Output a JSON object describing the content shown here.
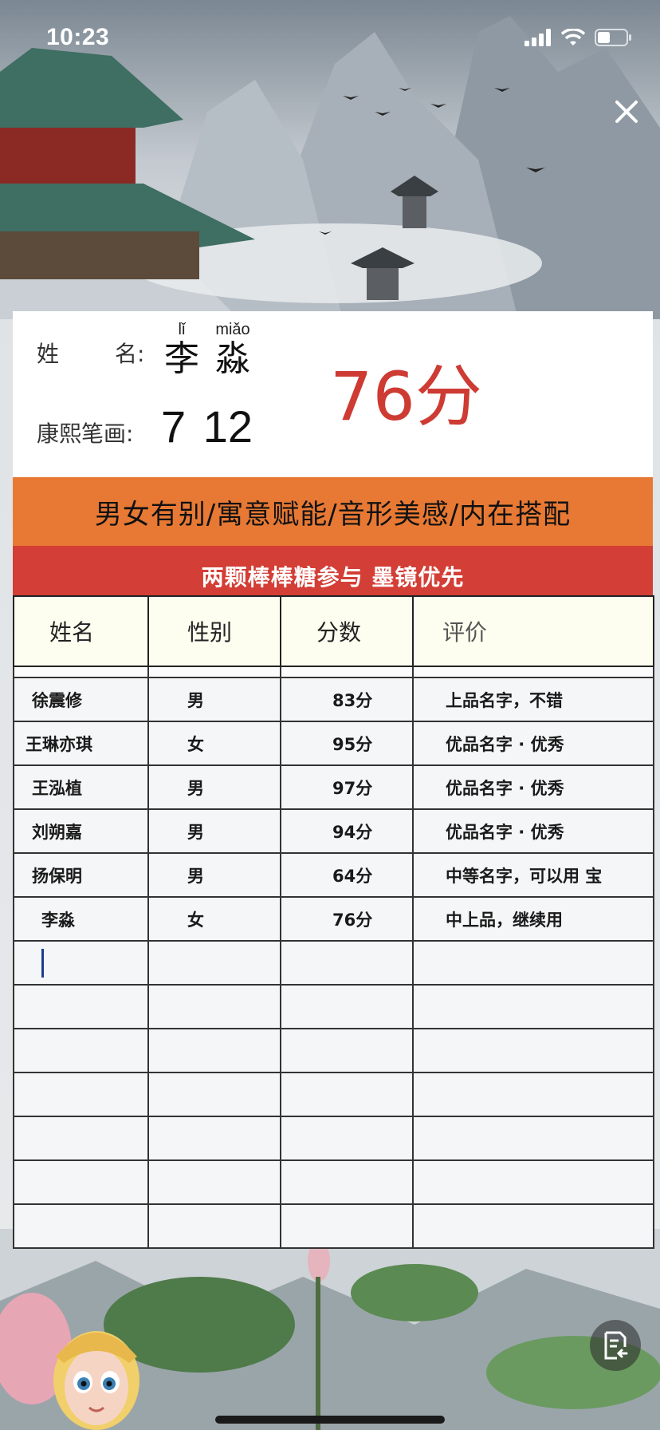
{
  "status_bar": {
    "time": "10:23",
    "icons": [
      "signal-icon",
      "wifi-icon",
      "battery-icon"
    ]
  },
  "close_icon": "close-icon",
  "info": {
    "name_label_1": "姓",
    "name_label_2": "名:",
    "name_chars": [
      {
        "pinyin": "lǐ",
        "hanzi": "李"
      },
      {
        "pinyin": "miǎo",
        "hanzi": "淼"
      }
    ],
    "strokes_label": "康熙笔画:",
    "strokes_value": "7 12",
    "score": "76分"
  },
  "banner_orange": "男女有别/寓意赋能/音形美感/内在搭配",
  "banner_red": "两颗棒棒糖参与  墨镜优先",
  "table": {
    "headers": [
      "姓名",
      "性别",
      "分数",
      "评价"
    ],
    "rows": [
      [
        "徐震修",
        "男",
        "83分",
        "上品名字，不错"
      ],
      [
        "王琳亦琪",
        "女",
        "95分",
        "优品名字 · 优秀"
      ],
      [
        "王泓植",
        "男",
        "97分",
        "优品名字 · 优秀"
      ],
      [
        "刘朔嘉",
        "男",
        "94分",
        "优品名字 · 优秀"
      ],
      [
        "扬保明",
        "男",
        "64分",
        "中等名字，可以用 宝"
      ],
      [
        "李淼",
        "女",
        "76分",
        "中上品，继续用"
      ],
      [
        "",
        "",
        "",
        ""
      ],
      [
        "",
        "",
        "",
        ""
      ],
      [
        "",
        "",
        "",
        ""
      ],
      [
        "",
        "",
        "",
        ""
      ],
      [
        "",
        "",
        "",
        ""
      ],
      [
        "",
        "",
        "",
        ""
      ],
      [
        "",
        "",
        "",
        ""
      ]
    ]
  },
  "colors": {
    "orange_banner": "#e77934",
    "red_banner": "#d33e36",
    "score_red": "#cd3b33",
    "header_bg": "#fefef0"
  },
  "floating": {
    "doc_button_icon": "document-icon",
    "avatar": "avatar"
  }
}
